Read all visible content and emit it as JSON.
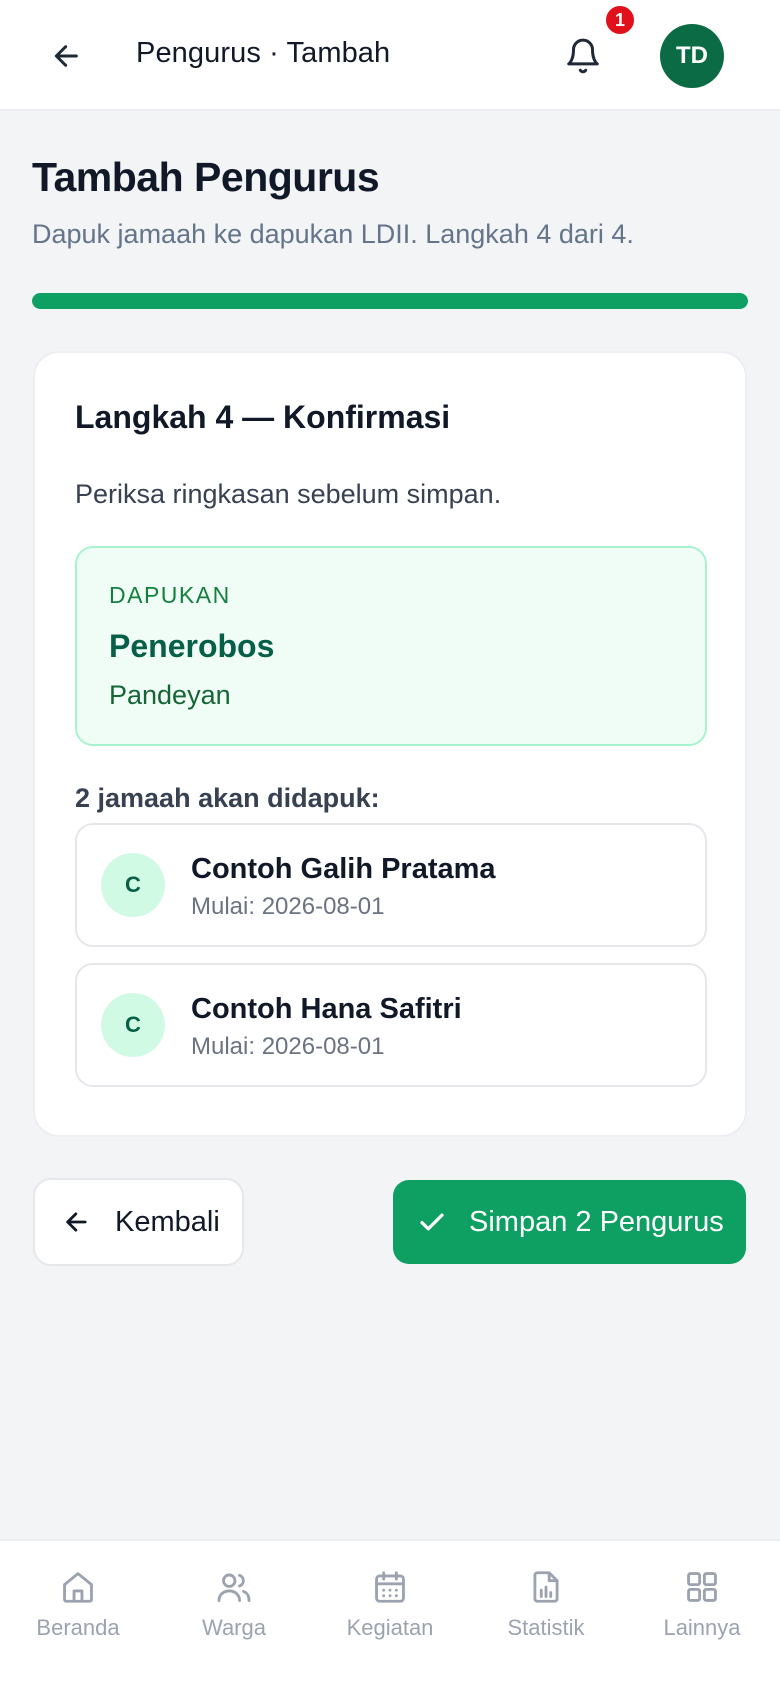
{
  "header": {
    "back_icon": "arrow-left-icon",
    "title": "Pengurus · Tambah",
    "bell_icon": "bell-icon",
    "notification_count": "1",
    "avatar_initials": "TD"
  },
  "page": {
    "title": "Tambah Pengurus",
    "subtitle": "Dapuk jamaah ke dapukan LDII. Langkah 4 dari 4.",
    "progress_percent": 100
  },
  "card": {
    "step_title": "Langkah 4 — Konfirmasi",
    "step_description": "Periksa ringkasan sebelum simpan.",
    "dapukan": {
      "label": "DAPUKAN",
      "name": "Penerobos",
      "place": "Pandeyan"
    },
    "count_text": "2 jamaah akan didapuk:",
    "members": [
      {
        "initial": "C",
        "name": "Contoh Galih Pratama",
        "start": "Mulai: 2026-08-01"
      },
      {
        "initial": "C",
        "name": "Contoh Hana Safitri",
        "start": "Mulai: 2026-08-01"
      }
    ]
  },
  "actions": {
    "back_label": "Kembali",
    "back_icon": "arrow-left-icon",
    "save_label": "Simpan 2 Pengurus",
    "save_icon": "check-icon"
  },
  "bottom_nav": {
    "items": [
      {
        "label": "Beranda",
        "icon": "home-icon"
      },
      {
        "label": "Warga",
        "icon": "users-icon"
      },
      {
        "label": "Kegiatan",
        "icon": "calendar-icon"
      },
      {
        "label": "Statistik",
        "icon": "chart-icon"
      },
      {
        "label": "Lainnya",
        "icon": "grid-icon"
      }
    ]
  },
  "colors": {
    "primary": "#0e9f62",
    "avatar_bg": "#0b6b45",
    "badge": "#e0111b",
    "nav_inactive": "#9ca3af"
  }
}
